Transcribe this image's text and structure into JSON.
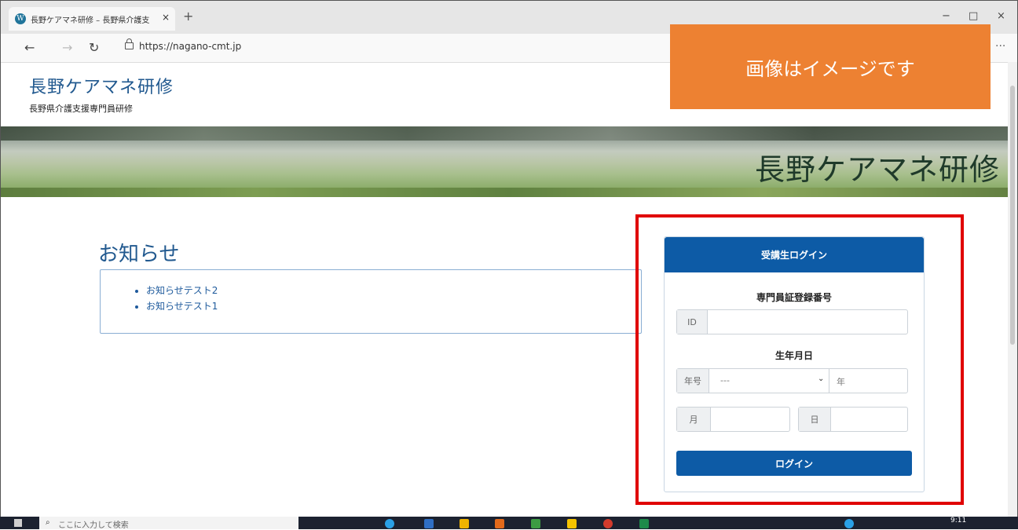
{
  "browser": {
    "tab_title": "長野ケアマネ研修 – 長野県介護支",
    "tab_close": "×",
    "new_tab": "+",
    "url": "https://nagano-cmt.jp",
    "more": "···",
    "win_min": "−",
    "win_max": "□",
    "win_close": "×"
  },
  "overlay": {
    "text": "画像はイメージです"
  },
  "site": {
    "title": "長野ケアマネ研修",
    "subtitle": "長野県介護支援専門員研修",
    "banner_title": "長野ケアマネ研修"
  },
  "news": {
    "heading": "お知らせ",
    "items": [
      "お知らせテスト2",
      "お知らせテスト1"
    ]
  },
  "login": {
    "header": "受講生ログイン",
    "id_label": "専門員証登録番号",
    "id_addon": "ID",
    "id_value": "",
    "dob_label": "生年月日",
    "era_addon": "年号",
    "era_selected": "---",
    "year_addon": "年",
    "month_addon": "月",
    "day_addon": "日",
    "button": "ログイン"
  },
  "taskbar": {
    "search_text": "ここに入力して検索",
    "clock": "9:11"
  },
  "colors": {
    "brand_blue": "#0d5ba6",
    "overlay_orange": "#ed8132",
    "highlight_red": "#e00000"
  }
}
